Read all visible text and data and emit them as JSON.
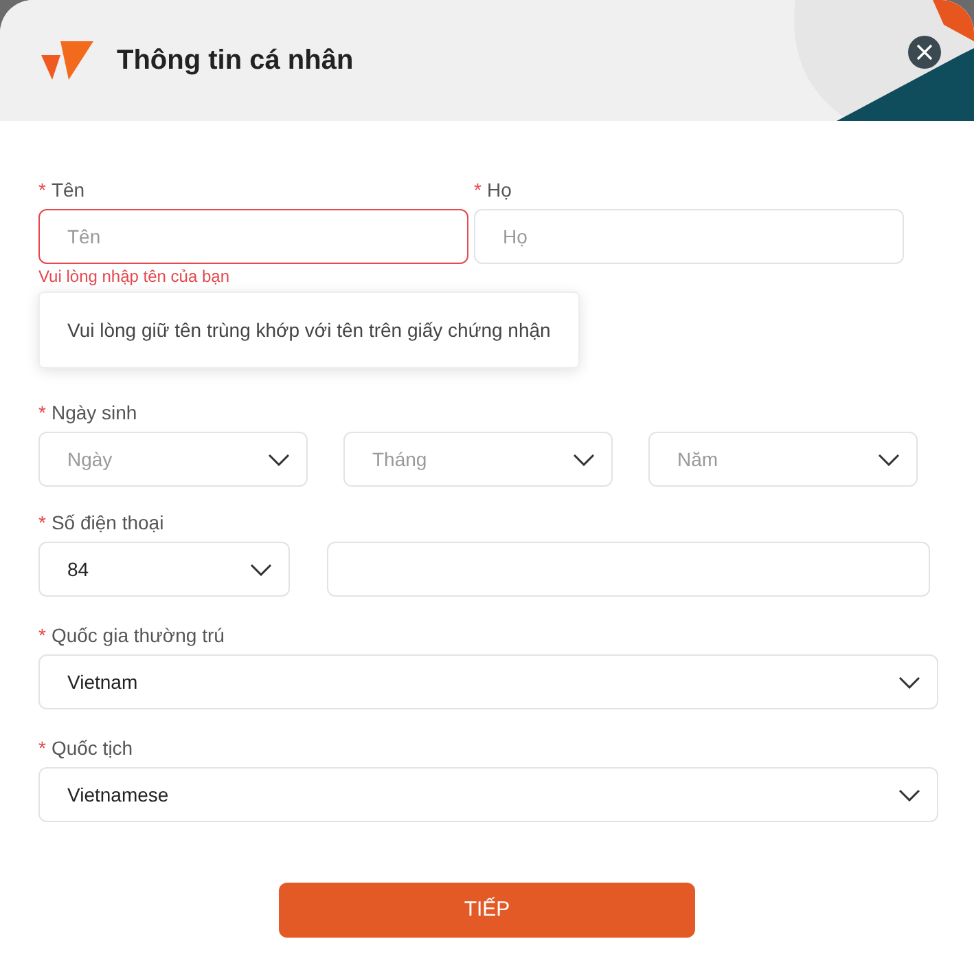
{
  "dialog": {
    "title": "Thông tin cá nhân"
  },
  "fields": [
    {
      "label": "Tên",
      "required_mark": "*",
      "placeholder": "Tên",
      "error": "Vui lòng nhập tên của bạn",
      "invalid": true
    },
    {
      "label": "Họ",
      "required_mark": "*",
      "placeholder": "Họ",
      "invalid": false
    }
  ],
  "tooltip": "Vui lòng giữ tên trùng khớp với tên trên giấy chứng nhận",
  "birth": {
    "label": "Ngày sinh",
    "required_mark": "*",
    "selects": [
      {
        "placeholder": "Ngày"
      },
      {
        "placeholder": "Tháng"
      },
      {
        "placeholder": "Năm"
      }
    ]
  },
  "phone": {
    "label": "Số điện thoại",
    "required_mark": "*",
    "code": "84"
  },
  "residence": {
    "label": "Quốc gia thường trú",
    "required_mark": "*",
    "value": "Vietnam"
  },
  "nationality": {
    "label": "Quốc tịch",
    "required_mark": "*",
    "value": "Vietnamese"
  },
  "submit": "TIẾP"
}
